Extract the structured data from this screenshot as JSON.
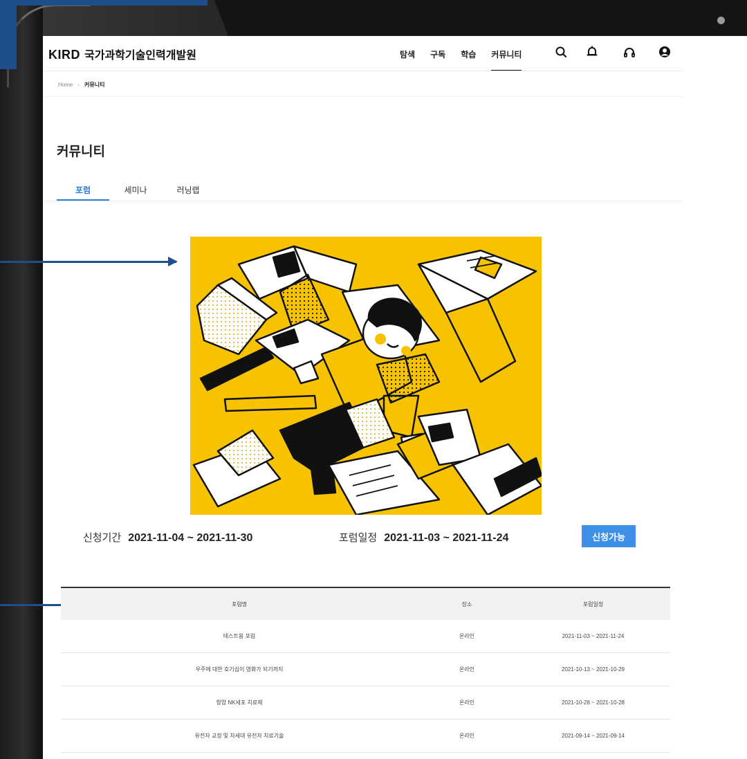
{
  "header": {
    "logo_brand": "KIRD",
    "logo_org": "국가과학기술인력개발원",
    "nav": [
      {
        "label": "탐색"
      },
      {
        "label": "구독"
      },
      {
        "label": "학습"
      },
      {
        "label": "커뮤니티",
        "active": true
      }
    ],
    "icons": [
      "search-icon",
      "bell-icon",
      "headphones-icon",
      "user-icon"
    ]
  },
  "breadcrumb": {
    "home": "Home",
    "current": "커뮤니티"
  },
  "page": {
    "title": "커뮤니티",
    "tabs": [
      {
        "label": "포럼",
        "active": true
      },
      {
        "label": "세미나"
      },
      {
        "label": "러닝랩"
      }
    ]
  },
  "forum_info": {
    "apply_label": "신청기간",
    "apply_period": "2021-11-04 ~ 2021-11-30",
    "schedule_label": "포럼일정",
    "schedule_period": "2021-11-03 ~ 2021-11-24",
    "button_label": "신청가능"
  },
  "table": {
    "headers": [
      "포럼명",
      "장소",
      "포럼일정"
    ],
    "rows": [
      {
        "name": "테스트용 포럼",
        "place": "온라인",
        "date": "2021-11-03 ~ 2021-11-24"
      },
      {
        "name": "우주에 대한 호기심이 영화가 되기까지",
        "place": "온라인",
        "date": "2021-10-13 ~ 2021-10-29"
      },
      {
        "name": "항암 NK세포 치료제",
        "place": "온라인",
        "date": "2021-10-28 ~ 2021-10-28"
      },
      {
        "name": "유전자 교정 및 차세대 유전자 치료기술",
        "place": "온라인",
        "date": "2021-09-14 ~ 2021-09-14"
      }
    ]
  },
  "colors": {
    "accent": "#2b7bd8",
    "button": "#3d8fe8",
    "illustration_bg": "#f7c300",
    "annotation_arrow": "#1f4e8c"
  }
}
